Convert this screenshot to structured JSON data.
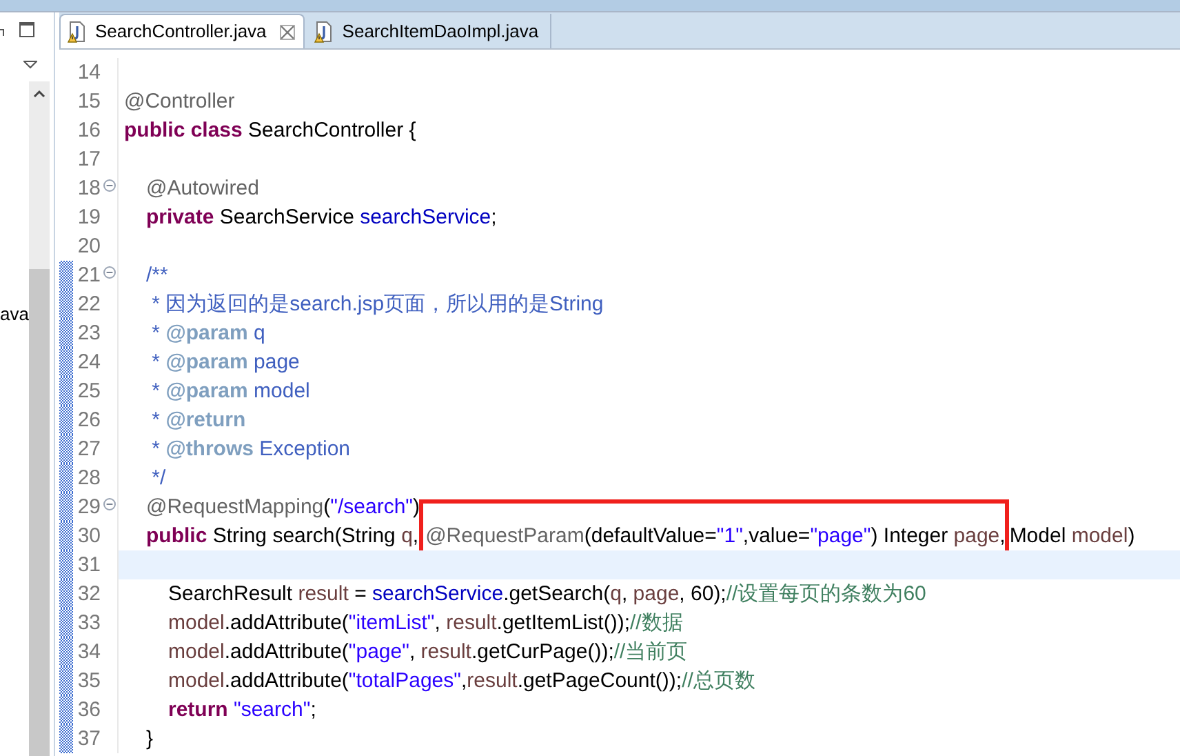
{
  "side_panel": {
    "partial_label": "ava"
  },
  "tabs": [
    {
      "label": "SearchController.java",
      "selected": true
    },
    {
      "label": "SearchItemDaoImpl.java",
      "selected": false
    }
  ],
  "editor": {
    "lines": [
      {
        "number": "14",
        "kind": "blank",
        "foldable": false,
        "changed": false,
        "current": false
      },
      {
        "number": "15",
        "kind": "top",
        "foldable": false,
        "changed": false,
        "current": false,
        "tokens": [
          {
            "kind": "ann",
            "text": "@Controller"
          }
        ]
      },
      {
        "number": "16",
        "kind": "top",
        "foldable": false,
        "changed": false,
        "current": false,
        "tokens": [
          {
            "kind": "kw",
            "text": "public class"
          },
          {
            "kind": "plain",
            "text": " SearchController {"
          }
        ]
      },
      {
        "number": "17",
        "kind": "blank",
        "foldable": false,
        "changed": false,
        "current": false
      },
      {
        "number": "18",
        "kind": "member",
        "foldable": true,
        "changed": false,
        "current": false,
        "tokens": [
          {
            "kind": "ann",
            "text": "@Autowired"
          }
        ]
      },
      {
        "number": "19",
        "kind": "member",
        "foldable": false,
        "changed": false,
        "current": false,
        "tokens": [
          {
            "kind": "kw",
            "text": "private"
          },
          {
            "kind": "plain",
            "text": " SearchService "
          },
          {
            "kind": "field",
            "text": "searchService"
          },
          {
            "kind": "plain",
            "text": ";"
          }
        ]
      },
      {
        "number": "20",
        "kind": "blank",
        "foldable": false,
        "changed": false,
        "current": false
      },
      {
        "number": "21",
        "kind": "member",
        "foldable": true,
        "changed": true,
        "current": false,
        "tokens": [
          {
            "kind": "doc",
            "text": "/**"
          }
        ]
      },
      {
        "number": "22",
        "kind": "member",
        "foldable": false,
        "changed": true,
        "current": false,
        "tokens": [
          {
            "kind": "doc",
            "text": " * 因为返回的是search.jsp页面，所以用的是String"
          }
        ]
      },
      {
        "number": "23",
        "kind": "member",
        "foldable": false,
        "changed": true,
        "current": false,
        "tokens": [
          {
            "kind": "doc",
            "text": " * "
          },
          {
            "kind": "doctag",
            "text": "@param"
          },
          {
            "kind": "doc",
            "text": " q"
          }
        ]
      },
      {
        "number": "24",
        "kind": "member",
        "foldable": false,
        "changed": true,
        "current": false,
        "tokens": [
          {
            "kind": "doc",
            "text": " * "
          },
          {
            "kind": "doctag",
            "text": "@param"
          },
          {
            "kind": "doc",
            "text": " page"
          }
        ]
      },
      {
        "number": "25",
        "kind": "member",
        "foldable": false,
        "changed": true,
        "current": false,
        "tokens": [
          {
            "kind": "doc",
            "text": " * "
          },
          {
            "kind": "doctag",
            "text": "@param"
          },
          {
            "kind": "doc",
            "text": " model"
          }
        ]
      },
      {
        "number": "26",
        "kind": "member",
        "foldable": false,
        "changed": true,
        "current": false,
        "tokens": [
          {
            "kind": "doc",
            "text": " * "
          },
          {
            "kind": "doctag",
            "text": "@return"
          }
        ]
      },
      {
        "number": "27",
        "kind": "member",
        "foldable": false,
        "changed": true,
        "current": false,
        "tokens": [
          {
            "kind": "doc",
            "text": " * "
          },
          {
            "kind": "doctag",
            "text": "@throws"
          },
          {
            "kind": "doc",
            "text": " Exception"
          }
        ]
      },
      {
        "number": "28",
        "kind": "member",
        "foldable": false,
        "changed": true,
        "current": false,
        "tokens": [
          {
            "kind": "doc",
            "text": " */"
          }
        ]
      },
      {
        "number": "29",
        "kind": "member",
        "foldable": true,
        "changed": true,
        "current": false,
        "tokens": [
          {
            "kind": "ann",
            "text": "@RequestMapping"
          },
          {
            "kind": "plain",
            "text": "("
          },
          {
            "kind": "str",
            "text": "\"/search\""
          },
          {
            "kind": "plain",
            "text": ")"
          }
        ]
      },
      {
        "number": "30",
        "kind": "member",
        "foldable": false,
        "changed": true,
        "current": false,
        "tokens": [
          {
            "kind": "kw",
            "text": "public"
          },
          {
            "kind": "plain",
            "text": " String search(String "
          },
          {
            "kind": "local",
            "text": "q"
          },
          {
            "kind": "plain",
            "text": ","
          }
        ],
        "boxed": [
          {
            "kind": "ann",
            "text": "@RequestParam"
          },
          {
            "kind": "plain",
            "text": "(defaultValue="
          },
          {
            "kind": "str",
            "text": "\"1\""
          },
          {
            "kind": "plain",
            "text": ",value="
          },
          {
            "kind": "str",
            "text": "\"page\""
          },
          {
            "kind": "plain",
            "text": ") Integer "
          },
          {
            "kind": "local",
            "text": "page"
          },
          {
            "kind": "plain",
            "text": ","
          }
        ],
        "after": [
          {
            "kind": "plain",
            "text": "Model "
          },
          {
            "kind": "local",
            "text": "model"
          },
          {
            "kind": "plain",
            "text": ")"
          }
        ]
      },
      {
        "number": "31",
        "kind": "blank",
        "foldable": false,
        "changed": true,
        "current": true
      },
      {
        "number": "32",
        "kind": "body",
        "foldable": false,
        "changed": true,
        "current": false,
        "tokens": [
          {
            "kind": "plain",
            "text": "SearchResult "
          },
          {
            "kind": "local",
            "text": "result"
          },
          {
            "kind": "plain",
            "text": " = "
          },
          {
            "kind": "field",
            "text": "searchService"
          },
          {
            "kind": "plain",
            "text": ".getSearch("
          },
          {
            "kind": "local",
            "text": "q"
          },
          {
            "kind": "plain",
            "text": ", "
          },
          {
            "kind": "local",
            "text": "page"
          },
          {
            "kind": "plain",
            "text": ", 60);"
          },
          {
            "kind": "com",
            "text": "//设置每页的条数为60"
          }
        ]
      },
      {
        "number": "33",
        "kind": "body",
        "foldable": false,
        "changed": true,
        "current": false,
        "tokens": [
          {
            "kind": "local",
            "text": "model"
          },
          {
            "kind": "plain",
            "text": ".addAttribute("
          },
          {
            "kind": "str",
            "text": "\"itemList\""
          },
          {
            "kind": "plain",
            "text": ", "
          },
          {
            "kind": "local",
            "text": "result"
          },
          {
            "kind": "plain",
            "text": ".getItemList());"
          },
          {
            "kind": "com",
            "text": "//数据"
          }
        ]
      },
      {
        "number": "34",
        "kind": "body",
        "foldable": false,
        "changed": true,
        "current": false,
        "tokens": [
          {
            "kind": "local",
            "text": "model"
          },
          {
            "kind": "plain",
            "text": ".addAttribute("
          },
          {
            "kind": "str",
            "text": "\"page\""
          },
          {
            "kind": "plain",
            "text": ", "
          },
          {
            "kind": "local",
            "text": "result"
          },
          {
            "kind": "plain",
            "text": ".getCurPage());"
          },
          {
            "kind": "com",
            "text": "//当前页"
          }
        ]
      },
      {
        "number": "35",
        "kind": "body",
        "foldable": false,
        "changed": true,
        "current": false,
        "tokens": [
          {
            "kind": "local",
            "text": "model"
          },
          {
            "kind": "plain",
            "text": ".addAttribute("
          },
          {
            "kind": "str",
            "text": "\"totalPages\""
          },
          {
            "kind": "plain",
            "text": ","
          },
          {
            "kind": "local",
            "text": "result"
          },
          {
            "kind": "plain",
            "text": ".getPageCount());"
          },
          {
            "kind": "com",
            "text": "//总页数"
          }
        ]
      },
      {
        "number": "36",
        "kind": "body",
        "foldable": false,
        "changed": true,
        "current": false,
        "tokens": [
          {
            "kind": "kw",
            "text": "return"
          },
          {
            "kind": "str",
            "text": " \"search\""
          },
          {
            "kind": "plain",
            "text": ";"
          }
        ]
      },
      {
        "number": "37",
        "kind": "member",
        "foldable": false,
        "changed": true,
        "current": false,
        "tokens": [
          {
            "kind": "plain",
            "text": "}"
          }
        ]
      }
    ]
  }
}
